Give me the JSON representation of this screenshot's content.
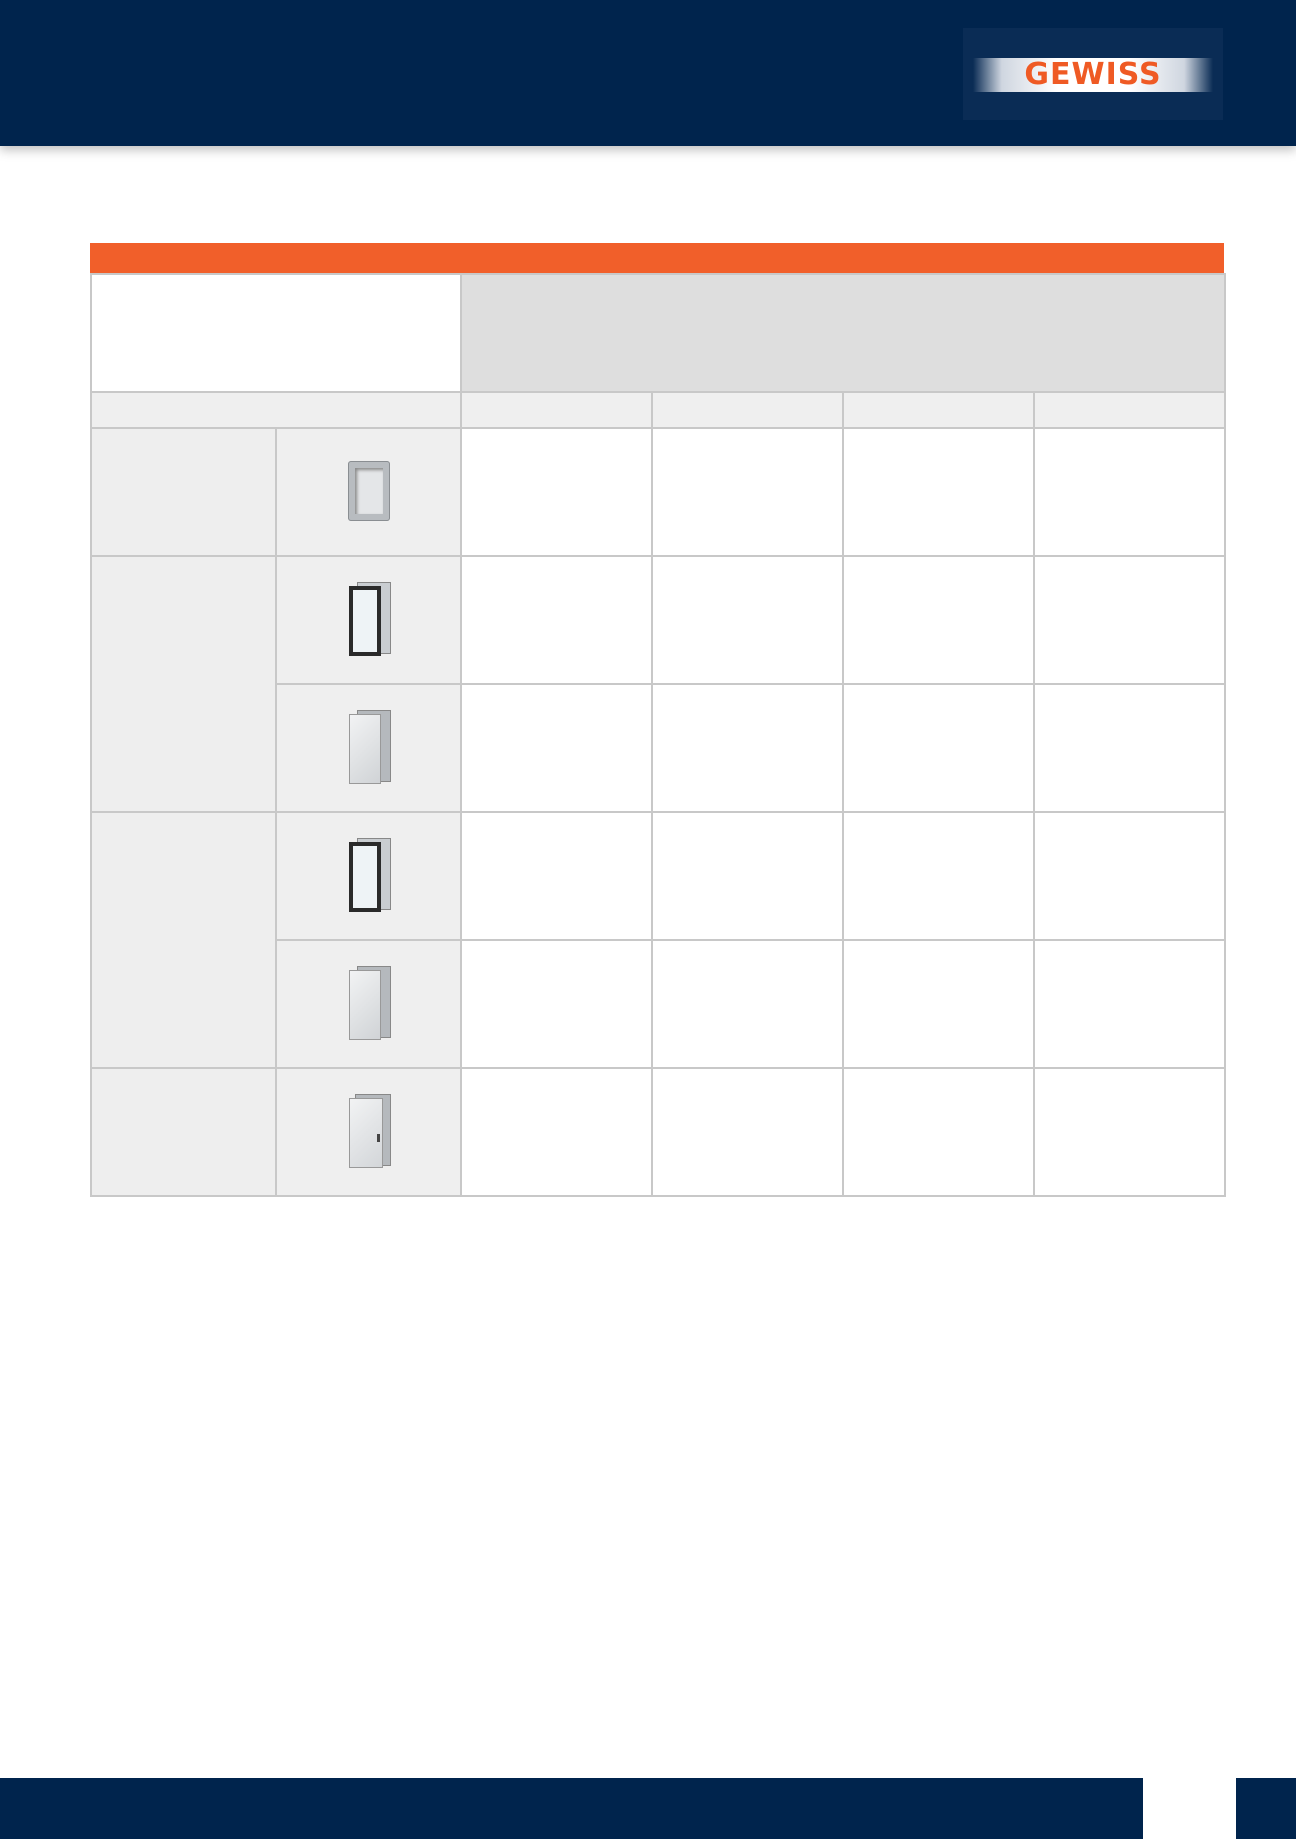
{
  "brand": {
    "logo_text": "GEWISS",
    "header_color": "#00244d",
    "accent_color": "#f15f2a"
  },
  "table": {
    "rows": [
      {
        "icon": "frame-icon"
      },
      {
        "icon": "transparent-door-icon"
      },
      {
        "icon": "opaque-door-icon"
      },
      {
        "icon": "transparent-door-icon"
      },
      {
        "icon": "opaque-door-icon"
      },
      {
        "icon": "door-with-lock-icon"
      }
    ]
  }
}
